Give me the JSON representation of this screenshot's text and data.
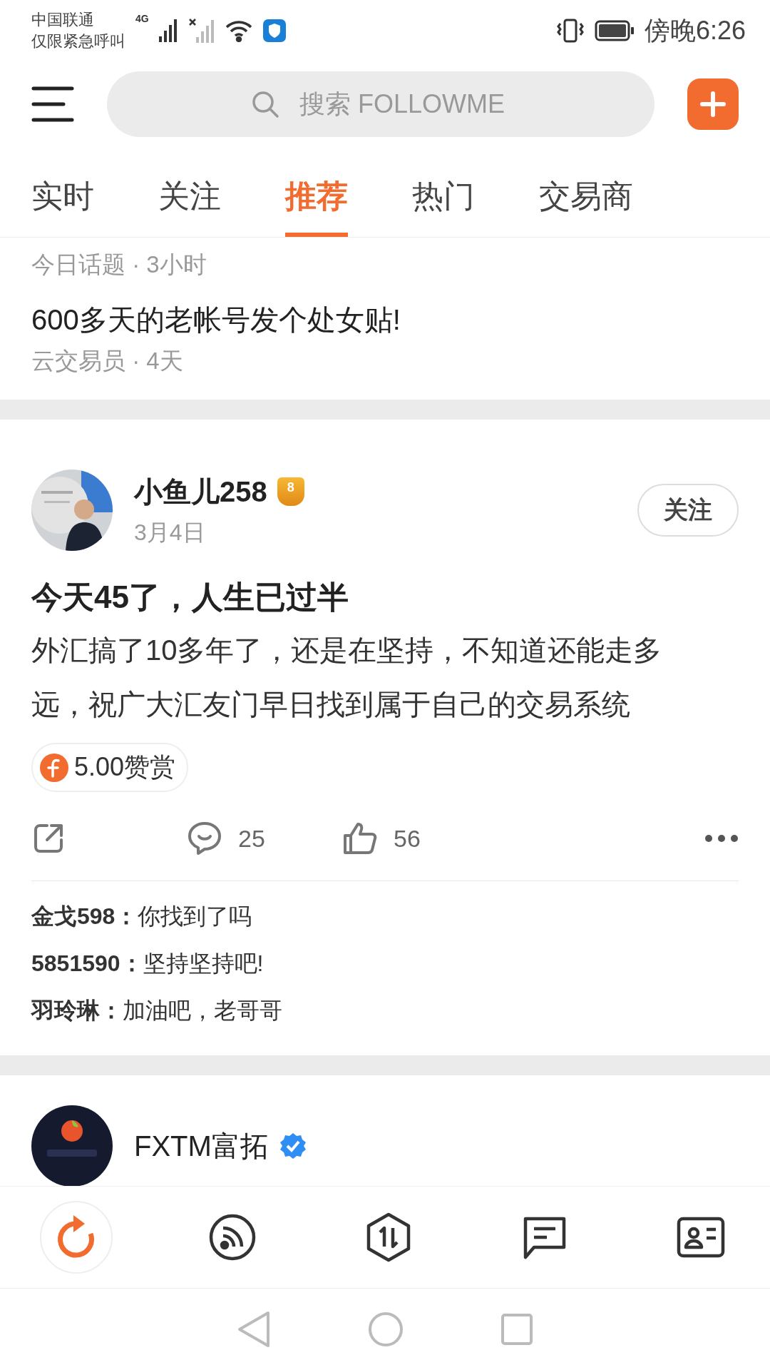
{
  "status_bar": {
    "carrier": "中国联通",
    "carrier_note": "仅限紧急呼叫",
    "network": "4G",
    "time": "傍晚6:26"
  },
  "header": {
    "search": {
      "placeholder": "搜索 FOLLOWME"
    }
  },
  "tabs": [
    {
      "label": "实时",
      "selected": false
    },
    {
      "label": "关注",
      "selected": false
    },
    {
      "label": "推荐",
      "selected": true
    },
    {
      "label": "热门",
      "selected": false
    },
    {
      "label": "交易商",
      "selected": false
    }
  ],
  "top_card": {
    "lines": [
      {
        "kind": "meta",
        "text": "今日话题 · 3小时"
      },
      {
        "kind": "title",
        "text": "600多天的老帐号发个处女贴!"
      },
      {
        "kind": "meta",
        "text": "云交易员 · 4天"
      }
    ]
  },
  "post": {
    "author": "小鱼儿258",
    "level_badge": "8",
    "date": "3月4日",
    "follow_label": "关注",
    "title": "今天45了，人生已过半",
    "body": "外汇搞了10多年了，还是在坚持，不知道还能走多远，祝广大汇友门早日找到属于自己的交易系统",
    "reward": "5.00赞赏",
    "comments_count": "25",
    "likes_count": "56",
    "comments": [
      {
        "text": "**金戈598：**你找到了吗"
      },
      {
        "text": "**5851590：**坚持坚持吧!"
      },
      {
        "text": "**羽玲琳：**加油吧，老哥哥"
      }
    ]
  },
  "ad_post": {
    "author": "FXTM富拓",
    "verified": true
  },
  "bottom_nav": [
    {
      "selected": true
    },
    {
      "selected": false
    },
    {
      "selected": false
    },
    {
      "selected": false
    },
    {
      "selected": false
    }
  ]
}
